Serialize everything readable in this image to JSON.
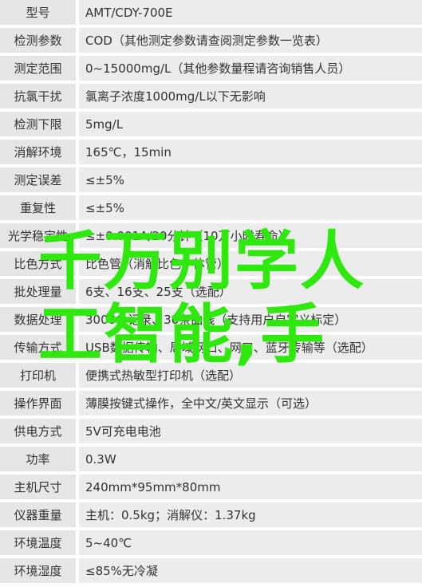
{
  "specs": [
    {
      "label": "型号",
      "value": "AMT/CDY-700E"
    },
    {
      "label": "检测参数",
      "value": "COD（其他测定参数请查阅测定参数一览表）"
    },
    {
      "label": "测定范围",
      "value": "0~15000mg/L（其他参数量程请咨询销售人员）"
    },
    {
      "label": "抗氯干扰",
      "value": "氯离子浓度1000mg/L以下无影响"
    },
    {
      "label": "检测下限",
      "value": "5mg/L"
    },
    {
      "label": "消解环境",
      "value": "165℃，15min"
    },
    {
      "label": "测定误差",
      "value": "≤±5%"
    },
    {
      "label": "重复性",
      "value": "≤±5%"
    },
    {
      "label": "光学稳定性",
      "value": "≤±0.001A/20分钟（10万小时寿命）"
    },
    {
      "label": "比色方式",
      "value": "比色管（消解比色一体管）"
    },
    {
      "label": "批处理量",
      "value": "6支、16支、25支（选配）"
    },
    {
      "label": "数据处理",
      "value": "3000条记录、30条曲线（支持用户自定义标定）"
    },
    {
      "label": "传输方式",
      "value": "USB数据传输、局域网口、网口、蓝牙传输等（选配）"
    },
    {
      "label": "打印机",
      "value": "便携式热敏型打印机（选配）"
    },
    {
      "label": "操作界面",
      "value": "薄膜按键式操作，全中文/英文显示（可选）"
    },
    {
      "label": "供电方式",
      "value": "5V可充电电池"
    },
    {
      "label": "功率",
      "value": "0.3W"
    },
    {
      "label": "主机尺寸",
      "value": "240mm*95mm*80mm"
    },
    {
      "label": "仪器重量",
      "value": "主机：0.5kg；消解仪：1.37kg"
    },
    {
      "label": "环境温度",
      "value": "5~40℃"
    },
    {
      "label": "环境湿度",
      "value": "≤85%无冷凝"
    }
  ],
  "overlay": {
    "line1": "千万别学人",
    "line2": "工智能,手",
    "color": "#2ee80e"
  }
}
